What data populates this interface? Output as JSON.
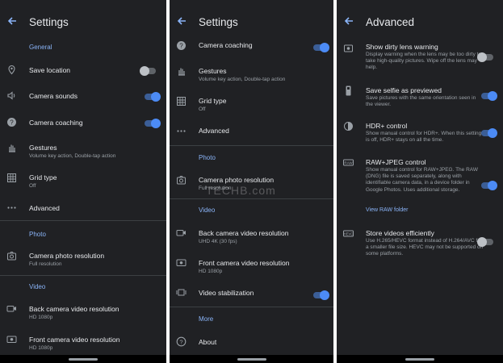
{
  "panel1": {
    "title": "Settings",
    "section_general": "General",
    "save_location": "Save location",
    "camera_sounds": "Camera sounds",
    "camera_coaching": "Camera coaching",
    "gestures": "Gestures",
    "gestures_sub": "Volume key action, Double-tap action",
    "grid_type": "Grid type",
    "grid_type_sub": "Off",
    "advanced": "Advanced",
    "section_photo": "Photo",
    "camera_photo_resolution": "Camera photo resolution",
    "camera_photo_resolution_sub": "Full resolution",
    "section_video": "Video",
    "back_video": "Back camera video resolution",
    "back_video_sub": "HD 1080p",
    "front_video": "Front camera video resolution",
    "front_video_sub": "HD 1080p"
  },
  "panel2": {
    "title": "Settings",
    "camera_coaching": "Camera coaching",
    "gestures": "Gestures",
    "gestures_sub": "Volume key action, Double-tap action",
    "grid_type": "Grid type",
    "grid_type_sub": "Off",
    "advanced": "Advanced",
    "section_photo": "Photo",
    "camera_photo_resolution": "Camera photo resolution",
    "camera_photo_resolution_sub": "Full resolution",
    "section_video": "Video",
    "back_video": "Back camera video resolution",
    "back_video_sub": "UHD 4K (30 fps)",
    "front_video": "Front camera video resolution",
    "front_video_sub": "HD 1080p",
    "video_stabilization": "Video stabilization",
    "section_more": "More",
    "about": "About"
  },
  "panel3": {
    "title": "Advanced",
    "dirty_lens": "Show dirty lens warning",
    "dirty_lens_desc": "Display warning when the lens may be too dirty to take high-quality pictures. Wipe off the lens may help.",
    "selfie": "Save selfie as previewed",
    "selfie_desc": "Save pictures with the same orientation seen in the viewer.",
    "hdr": "HDR+ control",
    "hdr_desc": "Show manual control for HDR+. When this setting is off, HDR+ stays on all the time.",
    "raw": "RAW+JPEG control",
    "raw_desc": "Show manual control for RAW+JPEG. The RAW (DNG) file is saved separately, along with identifiable camera data, in a device folder in Google Photos. Uses additional storage.",
    "view_raw": "View RAW folder",
    "store_videos": "Store videos efficiently",
    "store_videos_desc": "Use H.265/HEVC format instead of H.264/AVC for a smaller file size. HEVC may not be supported on some platforms."
  },
  "watermark": "TECHB.com",
  "toggles": {
    "p1_save_location": false,
    "p1_camera_sounds": true,
    "p1_camera_coaching": true,
    "p2_camera_coaching": true,
    "p2_video_stabilization": true,
    "p3_dirty_lens": false,
    "p3_selfie": true,
    "p3_hdr": true,
    "p3_raw": true,
    "p3_store_videos": false
  },
  "colors": {
    "background": "#202124",
    "accent": "#8ab4f8",
    "toggle_on": "#4c8bf5",
    "text": "#e8eaed",
    "subtext": "#9aa0a6"
  }
}
